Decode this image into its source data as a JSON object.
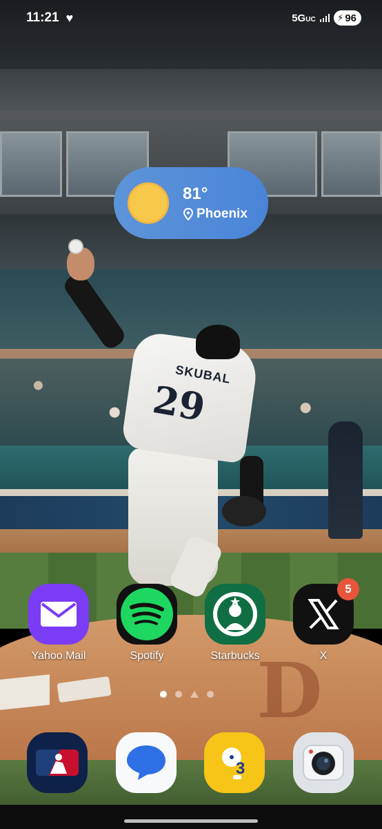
{
  "status_bar": {
    "time": "11:21",
    "network": "5G",
    "network_suffix": "UC",
    "battery": "96"
  },
  "weather": {
    "temperature": "81°",
    "location": "Phoenix"
  },
  "home_apps": [
    {
      "label": "Yahoo Mail",
      "icon": "envelope-icon"
    },
    {
      "label": "Spotify",
      "icon": "spotify-icon"
    },
    {
      "label": "Starbucks",
      "icon": "starbucks-icon"
    },
    {
      "label": "X",
      "icon": "x-logo-icon",
      "badge": "5"
    }
  ],
  "dock_apps": [
    {
      "name": "MLB",
      "icon": "mlb-icon"
    },
    {
      "name": "Messages",
      "icon": "chat-bubble-icon"
    },
    {
      "name": "Bixby",
      "icon": "bixby-icon"
    },
    {
      "name": "Camera",
      "icon": "camera-icon"
    }
  ],
  "wallpaper": {
    "jersey_name": "SKUBAL",
    "jersey_number": "29",
    "logo_letter": "D"
  },
  "page_indicator": {
    "pages": 4,
    "current": 1
  },
  "colors": {
    "weather_widget": "#4a84d8",
    "yahoo": "#7b3cf5",
    "spotify": "#1ed760",
    "starbucks": "#0f6e43",
    "badge": "#e8553a",
    "bixby": "#f6c517"
  }
}
